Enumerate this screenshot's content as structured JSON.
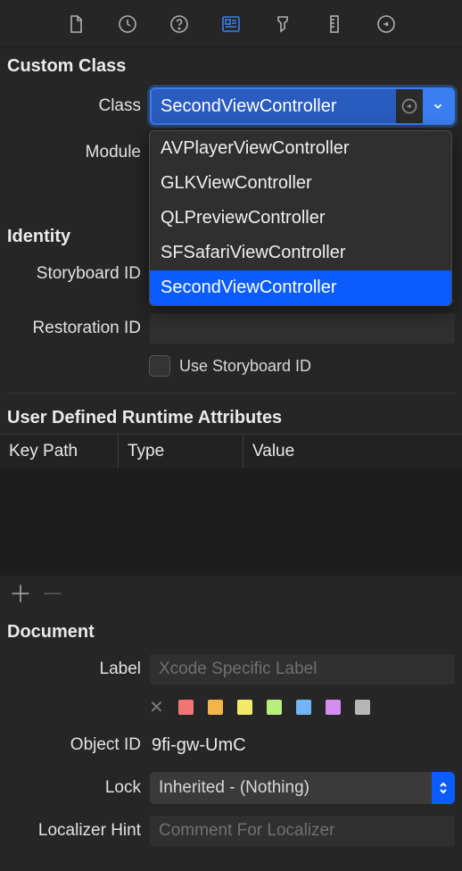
{
  "toolbar": {
    "icons": [
      "file",
      "history",
      "help",
      "identity",
      "attributes",
      "size",
      "connections"
    ]
  },
  "custom_class": {
    "title": "Custom Class",
    "class_label": "Class",
    "class_value": "SecondViewController",
    "module_label": "Module",
    "dropdown_options": [
      "AVPlayerViewController",
      "GLKViewController",
      "QLPreviewController",
      "SFSafariViewController",
      "SecondViewController"
    ],
    "selected_index": 4
  },
  "identity": {
    "title": "Identity",
    "storyboard_id_label": "Storyboard ID",
    "restoration_id_label": "Restoration ID",
    "restoration_id_value": "",
    "use_storyboard_checkbox_label": "Use Storyboard ID",
    "use_storyboard_checked": false
  },
  "udra": {
    "title": "User Defined Runtime Attributes",
    "columns": [
      "Key Path",
      "Type",
      "Value"
    ]
  },
  "document": {
    "title": "Document",
    "label_label": "Label",
    "label_placeholder": "Xcode Specific Label",
    "label_value": "",
    "swatches": [
      "#f27575",
      "#f2b54a",
      "#f2e96b",
      "#b7ee7d",
      "#72b4f6",
      "#d48ef0",
      "#b6b6b6"
    ],
    "object_id_label": "Object ID",
    "object_id_value": "9fi-gw-UmC",
    "lock_label": "Lock",
    "lock_value": "Inherited - (Nothing)",
    "localizer_hint_label": "Localizer Hint",
    "localizer_hint_placeholder": "Comment For Localizer",
    "localizer_hint_value": ""
  }
}
